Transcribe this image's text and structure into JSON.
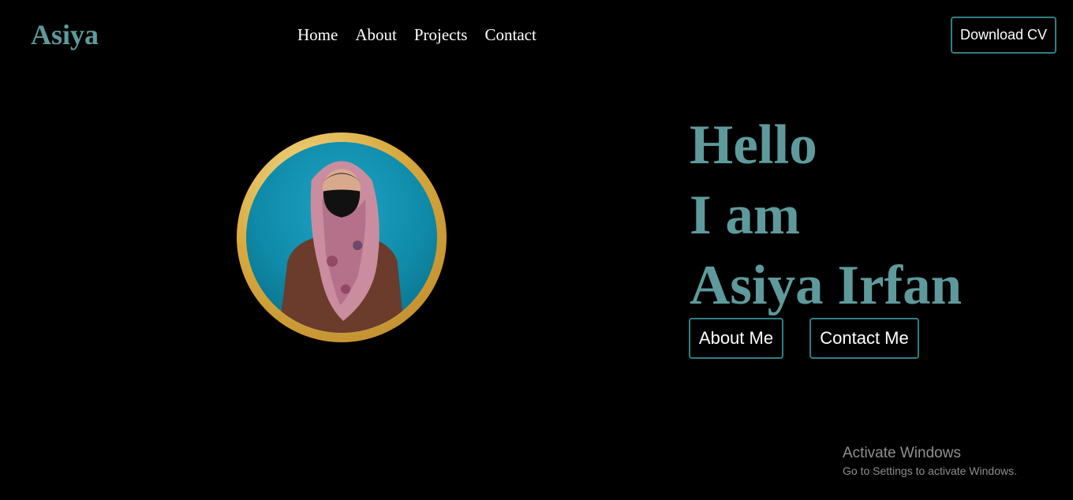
{
  "header": {
    "logo": "Asiya",
    "nav": [
      "Home",
      "About",
      "Projects",
      "Contact"
    ],
    "cv_button": "Download CV"
  },
  "hero": {
    "line1": "Hello",
    "line2": "I am",
    "line3": "Asiya Irfan",
    "about_button": "About Me",
    "contact_button": "Contact Me"
  },
  "watermark": {
    "title": "Activate Windows",
    "subtitle": "Go to Settings to activate Windows."
  },
  "colors": {
    "accent": "#5e9a9c",
    "button_border": "#2f7f86",
    "background": "#000000",
    "ring_gold": "#d8a93e"
  }
}
